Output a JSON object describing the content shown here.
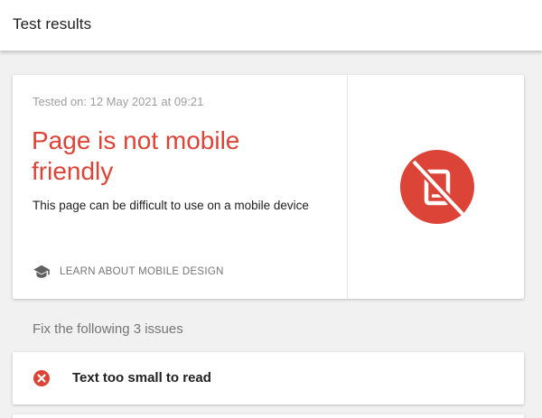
{
  "header": {
    "title": "Test results"
  },
  "result": {
    "tested_on": "Tested on: 12 May 2021 at 09:21",
    "verdict": "Page is not mobile friendly",
    "description": "This page can be difficult to use on a mobile device",
    "learn_link": "LEARN ABOUT MOBILE DESIGN",
    "verdict_color": "#db4437",
    "icon": "not-mobile-friendly-icon"
  },
  "issues": {
    "heading": "Fix the following 3 issues",
    "items": [
      {
        "label": "Text too small to read",
        "icon": "error-icon"
      }
    ]
  }
}
